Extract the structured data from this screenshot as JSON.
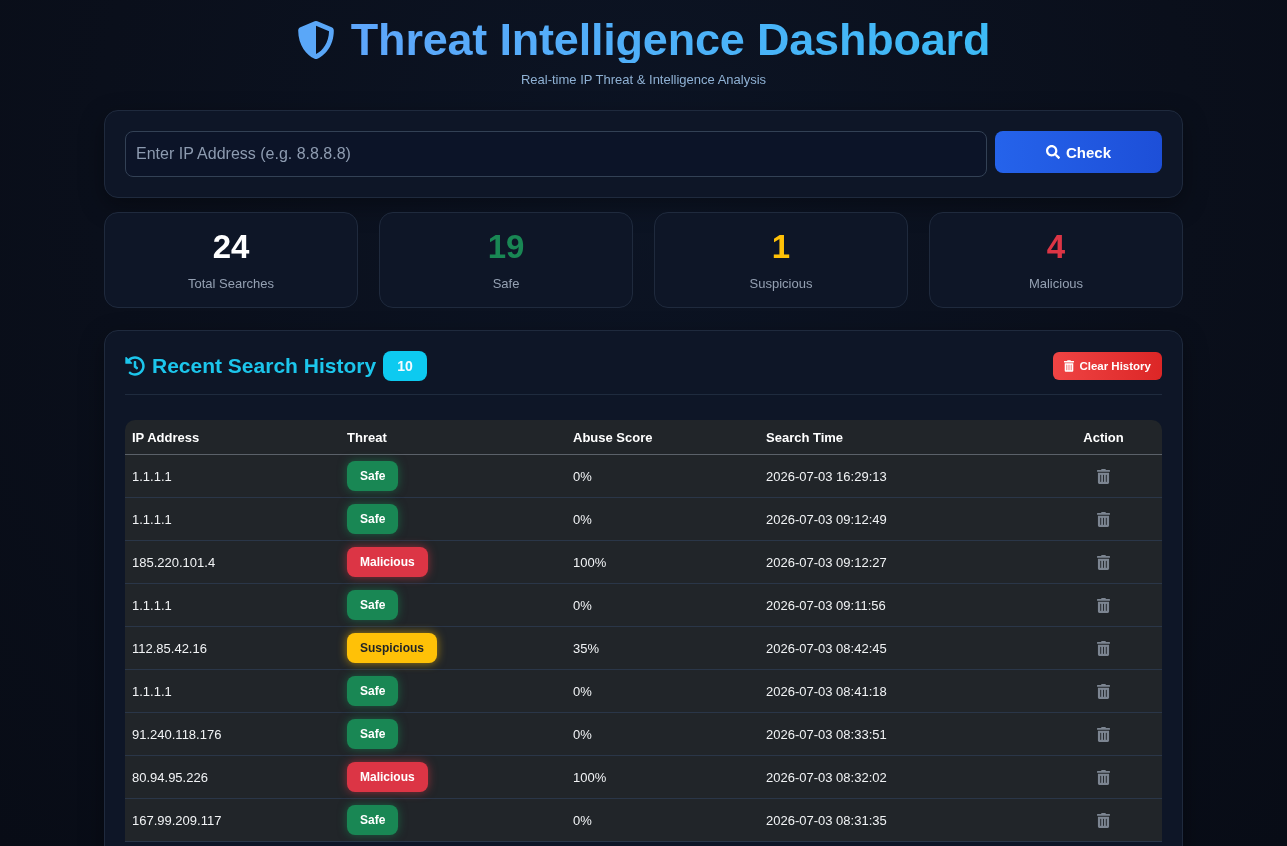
{
  "header": {
    "title": "Threat Intelligence Dashboard",
    "subtitle": "Real-time IP Threat & Intelligence Analysis"
  },
  "search": {
    "placeholder": "Enter IP Address (e.g. 8.8.8.8)",
    "button": "Check"
  },
  "stats": [
    {
      "value": "24",
      "label": "Total Searches",
      "kind": "total"
    },
    {
      "value": "19",
      "label": "Safe",
      "kind": "safe"
    },
    {
      "value": "1",
      "label": "Suspicious",
      "kind": "suspicious"
    },
    {
      "value": "4",
      "label": "Malicious",
      "kind": "malicious"
    }
  ],
  "history": {
    "title": "Recent Search History",
    "count": "10",
    "clear_button": "Clear History",
    "columns": [
      "IP Address",
      "Threat",
      "Abuse Score",
      "Search Time",
      "Action"
    ],
    "rows": [
      {
        "ip": "1.1.1.1",
        "threat": "Safe",
        "kind": "safe",
        "score": "0%",
        "time": "2026-07-03 16:29:13"
      },
      {
        "ip": "1.1.1.1",
        "threat": "Safe",
        "kind": "safe",
        "score": "0%",
        "time": "2026-07-03 09:12:49"
      },
      {
        "ip": "185.220.101.4",
        "threat": "Malicious",
        "kind": "malicious",
        "score": "100%",
        "time": "2026-07-03 09:12:27"
      },
      {
        "ip": "1.1.1.1",
        "threat": "Safe",
        "kind": "safe",
        "score": "0%",
        "time": "2026-07-03 09:11:56"
      },
      {
        "ip": "112.85.42.16",
        "threat": "Suspicious",
        "kind": "suspicious",
        "score": "35%",
        "time": "2026-07-03 08:42:45"
      },
      {
        "ip": "1.1.1.1",
        "threat": "Safe",
        "kind": "safe",
        "score": "0%",
        "time": "2026-07-03 08:41:18"
      },
      {
        "ip": "91.240.118.176",
        "threat": "Safe",
        "kind": "safe",
        "score": "0%",
        "time": "2026-07-03 08:33:51"
      },
      {
        "ip": "80.94.95.226",
        "threat": "Malicious",
        "kind": "malicious",
        "score": "100%",
        "time": "2026-07-03 08:32:02"
      },
      {
        "ip": "167.99.209.117",
        "threat": "Safe",
        "kind": "safe",
        "score": "0%",
        "time": "2026-07-03 08:31:35"
      }
    ]
  }
}
